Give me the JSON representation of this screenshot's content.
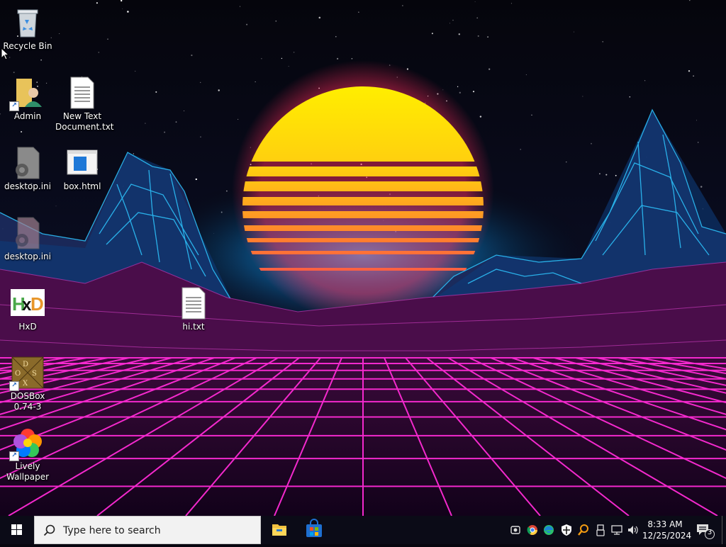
{
  "desktop": {
    "icons": [
      {
        "id": "recycle-bin",
        "label": "Recycle Bin"
      },
      {
        "id": "admin",
        "label": "Admin"
      },
      {
        "id": "new-text-document",
        "label": "New Text Document.txt"
      },
      {
        "id": "desktop-ini-1",
        "label": "desktop.ini"
      },
      {
        "id": "box-html",
        "label": "box.html"
      },
      {
        "id": "desktop-ini-2",
        "label": "desktop.ini"
      },
      {
        "id": "hxd",
        "label": "HxD"
      },
      {
        "id": "hi-txt",
        "label": "hi.txt"
      },
      {
        "id": "dosbox",
        "label": "DOSBox 0.74-3"
      },
      {
        "id": "lively-wallpaper",
        "label": "Lively Wallpaper"
      }
    ]
  },
  "taskbar": {
    "search_placeholder": "Type here to search",
    "apps": [
      "file-explorer-icon",
      "microsoft-store-icon"
    ],
    "tray_icons": [
      "capture-icon",
      "chrome-icon",
      "edge-icon",
      "security-shield-icon",
      "search-tool-icon",
      "usb-icon",
      "network-icon",
      "volume-icon"
    ],
    "clock": {
      "time": "8:33 AM",
      "date": "12/25/2024"
    },
    "notification_count": "3"
  },
  "colors": {
    "taskbar": "#0b0b17",
    "sun_top": "#ffe600",
    "sun_bottom": "#ff2a6a",
    "grid": "#ff2bd6",
    "mountain_lines": "#2ec6ff"
  }
}
